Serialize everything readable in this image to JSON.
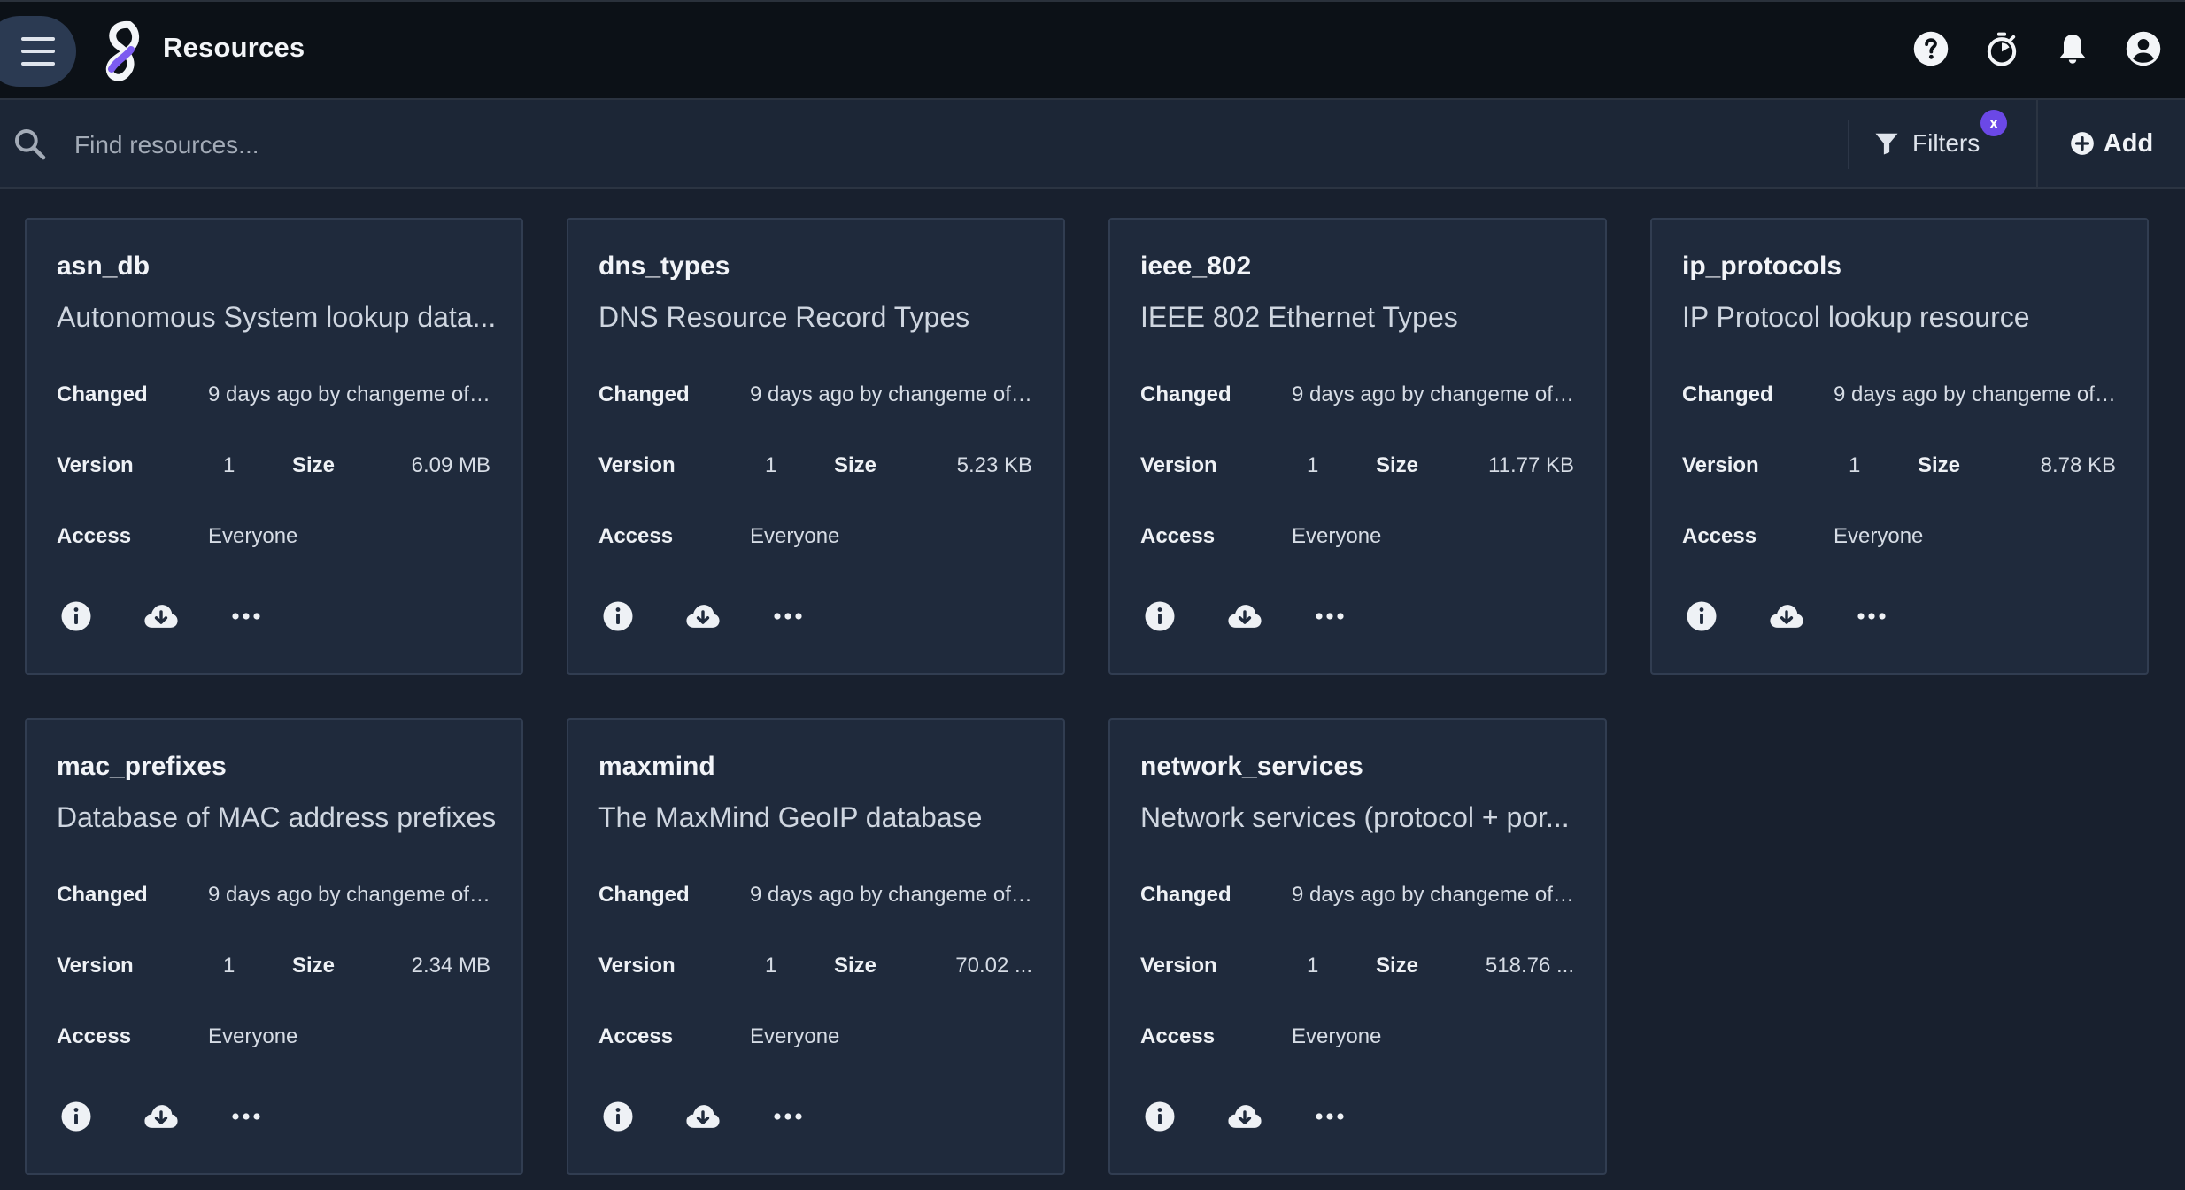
{
  "header": {
    "title": "Resources",
    "icons": [
      "menu-icon",
      "logo-icon",
      "help-icon",
      "stopwatch-icon",
      "bell-icon",
      "account-icon"
    ]
  },
  "search": {
    "placeholder": "Find resources...",
    "filters_label": "Filters",
    "filter_badge": "x",
    "add_label": "Add"
  },
  "labels": {
    "changed": "Changed",
    "version": "Version",
    "size": "Size",
    "access": "Access"
  },
  "resources": [
    {
      "name": "asn_db",
      "description": "Autonomous System lookup data...",
      "changed": "9 days ago by changeme of ...",
      "version": "1",
      "size": "6.09 MB",
      "access": "Everyone"
    },
    {
      "name": "dns_types",
      "description": "DNS Resource Record Types",
      "changed": "9 days ago by changeme of ...",
      "version": "1",
      "size": "5.23 KB",
      "access": "Everyone"
    },
    {
      "name": "ieee_802",
      "description": "IEEE 802 Ethernet Types",
      "changed": "9 days ago by changeme of ...",
      "version": "1",
      "size": "11.77 KB",
      "access": "Everyone"
    },
    {
      "name": "ip_protocols",
      "description": "IP Protocol lookup resource",
      "changed": "9 days ago by changeme of ...",
      "version": "1",
      "size": "8.78 KB",
      "access": "Everyone"
    },
    {
      "name": "mac_prefixes",
      "description": "Database of MAC address prefixes",
      "changed": "9 days ago by changeme of ...",
      "version": "1",
      "size": "2.34 MB",
      "access": "Everyone"
    },
    {
      "name": "maxmind",
      "description": "The MaxMind GeoIP database",
      "changed": "9 days ago by changeme of ...",
      "version": "1",
      "size": "70.02 ...",
      "access": "Everyone"
    },
    {
      "name": "network_services",
      "description": "Network services (protocol + por...",
      "changed": "9 days ago by changeme of ...",
      "version": "1",
      "size": "518.76 ...",
      "access": "Everyone"
    }
  ],
  "card_actions": [
    "info-icon",
    "download-icon",
    "more-icon"
  ],
  "colors": {
    "topbar_bg": "#0c1117",
    "page_bg": "#18202e",
    "card_bg": "#1f2a3c",
    "accent": "#6b48e6"
  }
}
